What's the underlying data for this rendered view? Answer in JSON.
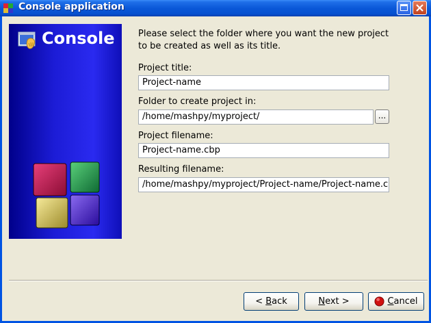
{
  "window": {
    "title": "Console application"
  },
  "banner": {
    "title": "Console"
  },
  "form": {
    "intro": "Please select the folder where you want the new project to be created as well as its title.",
    "project_title_label": "Project title:",
    "project_title_value": "Project-name",
    "folder_label": "Folder to create project in:",
    "folder_value": "/home/mashpy/myproject/",
    "browse_label": "...",
    "filename_label": "Project filename:",
    "filename_value": "Project-name.cbp",
    "resulting_label": "Resulting filename:",
    "resulting_value": "/home/mashpy/myproject/Project-name/Project-name.c"
  },
  "buttons": {
    "back_prefix": "< ",
    "back_hotkey": "B",
    "back_rest": "ack",
    "next_hotkey": "N",
    "next_rest": "ext >",
    "cancel_hotkey": "C",
    "cancel_rest": "ancel"
  },
  "icons": {
    "app": "codeblocks-icon",
    "banner": "console-wizard-icon",
    "cancel": "stop-icon",
    "maximize": "maximize-icon",
    "close": "close-icon"
  }
}
